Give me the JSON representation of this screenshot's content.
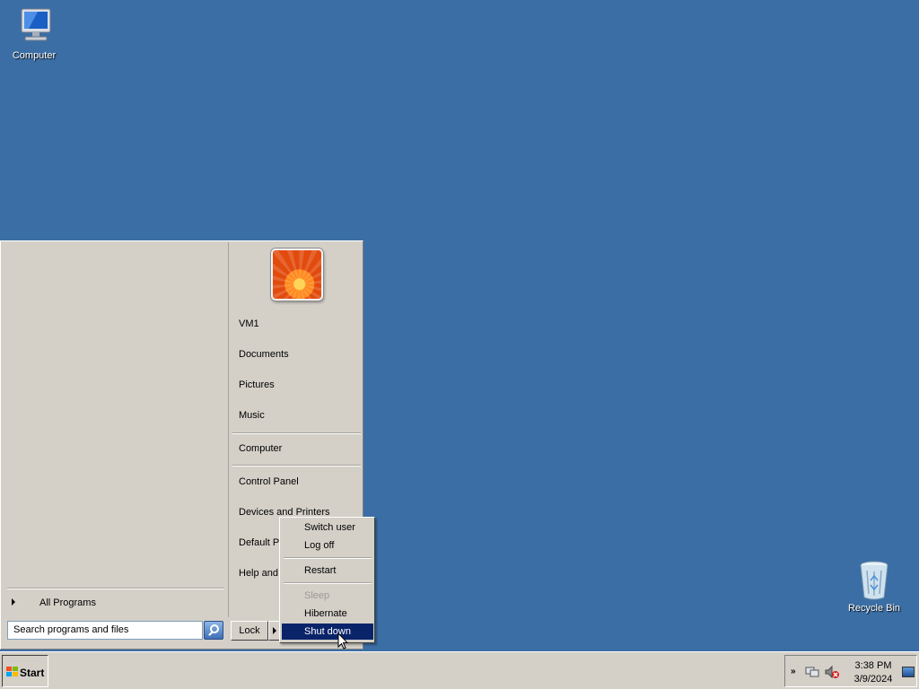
{
  "desktop": {
    "background": "#3b6ea5",
    "icons": [
      {
        "label": "Computer",
        "icon": "computer-icon"
      },
      {
        "label": "Recycle Bin",
        "icon": "recycle-bin-icon"
      }
    ]
  },
  "start_menu": {
    "user_tile_icon": "user-picture-flower",
    "right_items": [
      "VM1",
      "Documents",
      "Pictures",
      "Music",
      "Computer",
      "Control Panel",
      "Devices and Printers",
      "Default P",
      "Help and"
    ],
    "all_programs": "All Programs",
    "search_placeholder": "Search programs and files",
    "lock_button": "Lock",
    "shutdown_submenu": {
      "items": [
        {
          "label": "Switch user",
          "state": "normal"
        },
        {
          "label": "Log off",
          "state": "normal"
        },
        {
          "label": "Restart",
          "state": "normal"
        },
        {
          "label": "Sleep",
          "state": "disabled"
        },
        {
          "label": "Hibernate",
          "state": "normal"
        },
        {
          "label": "Shut down",
          "state": "selected"
        }
      ],
      "selected_color": "#0a246a"
    }
  },
  "taskbar": {
    "start_label": "Start",
    "tray_expand": "»",
    "clock_time": "3:38 PM",
    "clock_date": "3/9/2024"
  }
}
